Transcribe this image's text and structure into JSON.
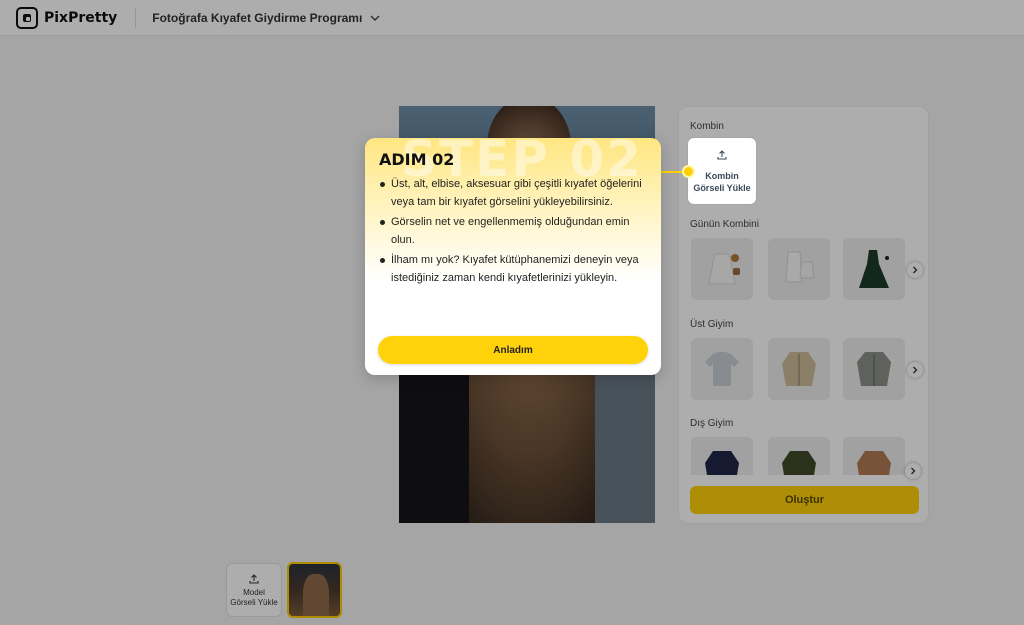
{
  "header": {
    "logo_text": "PixPretty",
    "app_title": "Fotoğrafa Kıyafet Giydirme Programı"
  },
  "panel": {
    "kombin_label": "Kombin",
    "upload_label_line1": "Kombin",
    "upload_label_line2": "Görseli Yükle",
    "sections": [
      {
        "label": "Günün Kombini"
      },
      {
        "label": "Üst Giyim"
      },
      {
        "label": "Dış Giyim"
      }
    ],
    "create_label": "Oluştur"
  },
  "model": {
    "upload_line1": "Model",
    "upload_line2": "Görseli Yükle"
  },
  "tooltip": {
    "watermark": "STEP 02",
    "title": "ADIM 02",
    "bullets": [
      "Üst, alt, elbise, aksesuar gibi çeşitli kıyafet öğelerini veya tam bir kıyafet görselini yükleyebilirsiniz.",
      "Görselin net ve engellenmemiş olduğundan emin olun.",
      "İlham mı yok? Kıyafet kütüphanemizi deneyin veya istediğiniz zaman kendi kıyafetlerinizi yükleyin."
    ],
    "button_label": "Anladım"
  },
  "colors": {
    "accent": "#ffd20a",
    "overlay": "rgba(0,0,0,0.32)"
  }
}
